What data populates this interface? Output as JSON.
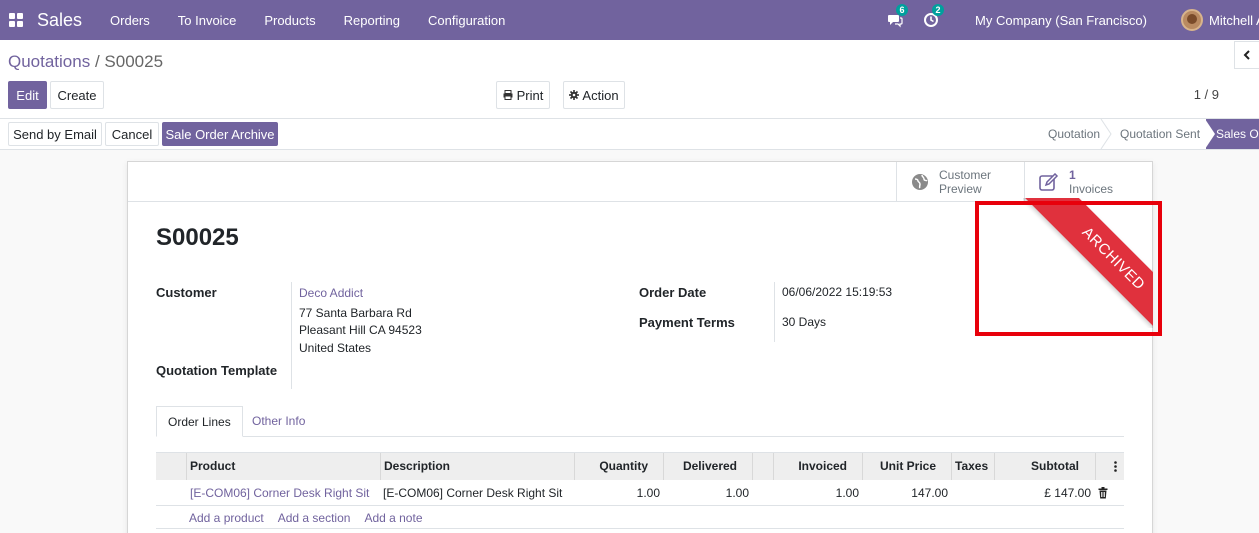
{
  "navbar": {
    "app_name": "Sales",
    "menu": [
      "Orders",
      "To Invoice",
      "Products",
      "Reporting",
      "Configuration"
    ],
    "messages_count": "6",
    "activities_count": "2",
    "company": "My Company (San Francisco)",
    "user": "Mitchell Admin"
  },
  "breadcrumb": {
    "parent": "Quotations",
    "separator": " / ",
    "current": "S00025"
  },
  "toolbar": {
    "edit": "Edit",
    "create": "Create",
    "print": "Print",
    "action": "Action",
    "pager": "1 / 9"
  },
  "header_buttons": {
    "send_email": "Send by Email",
    "cancel": "Cancel",
    "archive": "Sale Order Archive"
  },
  "stages": {
    "quotation": "Quotation",
    "quotation_sent": "Quotation Sent",
    "sales_order": "Sales Order"
  },
  "smart_buttons": {
    "preview_line1": "Customer",
    "preview_line2": "Preview",
    "invoices_count": "1",
    "invoices_label": "Invoices"
  },
  "ribbon": "ARCHIVED",
  "order": {
    "name": "S00025",
    "customer_label": "Customer",
    "customer_name": "Deco Addict",
    "address_line1": "77 Santa Barbara Rd",
    "address_line2": "Pleasant Hill CA 94523",
    "address_line3": "United States",
    "template_label": "Quotation Template",
    "order_date_label": "Order Date",
    "order_date": "06/06/2022 15:19:53",
    "payment_terms_label": "Payment Terms",
    "payment_terms": "30 Days"
  },
  "tabs": {
    "order_lines": "Order Lines",
    "other_info": "Other Info"
  },
  "lines": {
    "columns": {
      "product": "Product",
      "description": "Description",
      "quantity": "Quantity",
      "delivered": "Delivered",
      "invoiced": "Invoiced",
      "unit_price": "Unit Price",
      "taxes": "Taxes",
      "subtotal": "Subtotal"
    },
    "rows": [
      {
        "product": "[E-COM06] Corner Desk Right Sit",
        "description": "[E-COM06] Corner Desk Right Sit",
        "quantity": "1.00",
        "delivered": "1.00",
        "invoiced": "1.00",
        "unit_price": "147.00",
        "taxes": "",
        "subtotal": "£ 147.00"
      }
    ],
    "add_product": "Add a product",
    "add_section": "Add a section",
    "add_note": "Add a note"
  },
  "colors": {
    "brand": "#71639e",
    "ribbon": "#e0313d",
    "highlight": "#e8000b",
    "badge": "#00a09d"
  }
}
